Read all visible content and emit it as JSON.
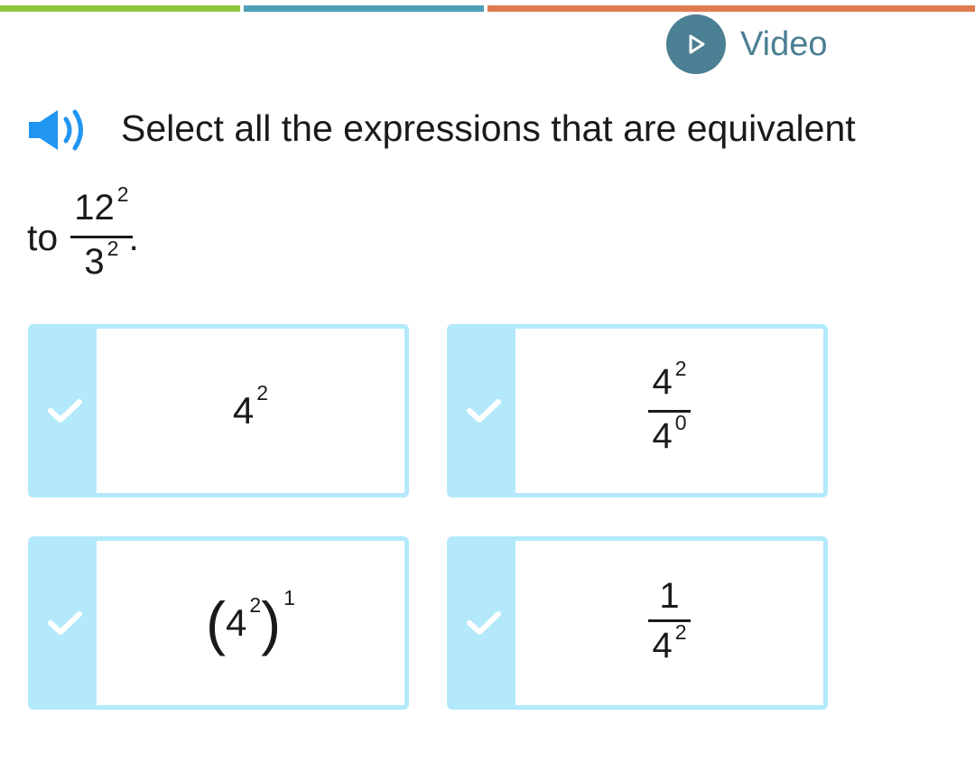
{
  "colors": {
    "progress_segments": [
      "#8cc63f",
      "#4a9fb5",
      "#e07a4f"
    ],
    "video_button": "#4b7f93",
    "card_accent": "#b3e9fb",
    "check": "#ffffff"
  },
  "header": {
    "video_label": "Video",
    "video_icon": "play-icon"
  },
  "question": {
    "speaker_icon": "speaker-icon",
    "prompt_line1": "Select all the expressions that are equivalent",
    "prompt_to": "to",
    "fraction": {
      "num_base": "12",
      "num_exp": "2",
      "den_base": "3",
      "den_exp": "2"
    },
    "end_punct": "."
  },
  "choices": [
    {
      "selected": true,
      "base": "4",
      "exp": "2"
    },
    {
      "selected": true,
      "num_base": "4",
      "num_exp": "2",
      "den_base": "4",
      "den_exp": "0"
    },
    {
      "selected": true,
      "open_paren": "(",
      "base": "4",
      "exp": "2",
      "close_paren": ")",
      "outer_exp": "1"
    },
    {
      "selected": true,
      "num": "1",
      "den_base": "4",
      "den_exp": "2"
    }
  ]
}
